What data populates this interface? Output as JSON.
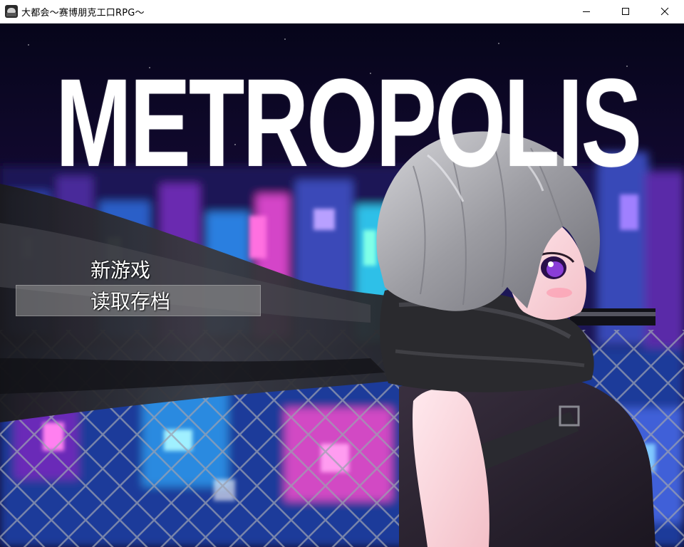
{
  "window": {
    "title": "大都会～赛博朋克工口RPG～",
    "app_icon": "game-character-icon",
    "controls": [
      "minimize-icon",
      "maximize-icon",
      "close-icon"
    ]
  },
  "game": {
    "logo_text": "METROPOLIS",
    "menu": [
      {
        "label": "新游戏",
        "selected": false
      },
      {
        "label": "读取存档",
        "selected": true
      }
    ]
  },
  "colors": {
    "titlebar_bg": "#ffffff",
    "menu_text": "#ffffff",
    "menu_highlight": "#969696",
    "hair": "#a8a8ac",
    "scarf": "#2a2a2e",
    "eye": "#8a3dd8",
    "city_pink": "#e64fd2",
    "city_cyan": "#3fd9ff"
  }
}
